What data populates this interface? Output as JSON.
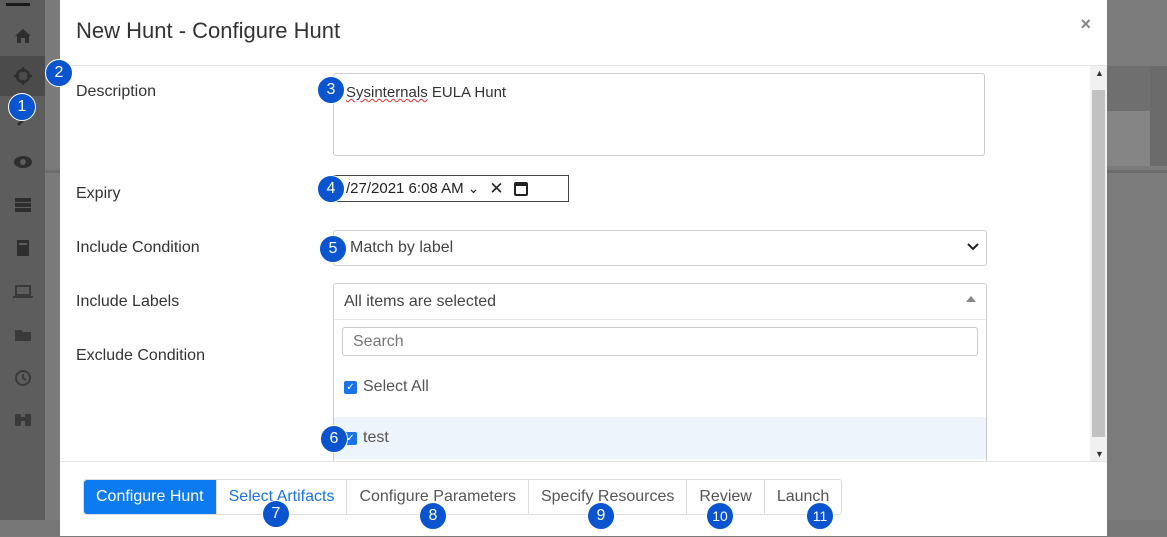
{
  "modal": {
    "title": "New Hunt - Configure Hunt",
    "close": "×"
  },
  "form": {
    "description_label": "Description",
    "description_word1": "Sysinternals",
    "description_rest": " EULA Hunt",
    "expiry_label": "Expiry",
    "expiry_value": "/27/2021 6:08  AM",
    "expiry_ampm_arrow": "⌄",
    "include_condition_label": "Include Condition",
    "include_condition_value": "Match by label",
    "include_labels_label": "Include Labels",
    "exclude_condition_label": "Exclude Condition",
    "multiselect_header": "All items are selected",
    "search_placeholder": "Search",
    "options": [
      "Select All",
      "test"
    ]
  },
  "footer": {
    "tabs": [
      "Configure Hunt",
      "Select Artifacts",
      "Configure Parameters",
      "Specify Resources",
      "Review",
      "Launch"
    ]
  },
  "badges": [
    "1",
    "2",
    "3",
    "4",
    "5",
    "6",
    "7",
    "8",
    "9",
    "10",
    "11"
  ],
  "colors": {
    "accent": "#0d7bf0",
    "badge": "#0a55cf"
  },
  "icons": [
    "home-icon",
    "crosshair-icon",
    "wrench-icon",
    "eye-icon",
    "server-icon",
    "book-icon",
    "laptop-icon",
    "folder-icon",
    "history-icon",
    "binoculars-icon"
  ]
}
